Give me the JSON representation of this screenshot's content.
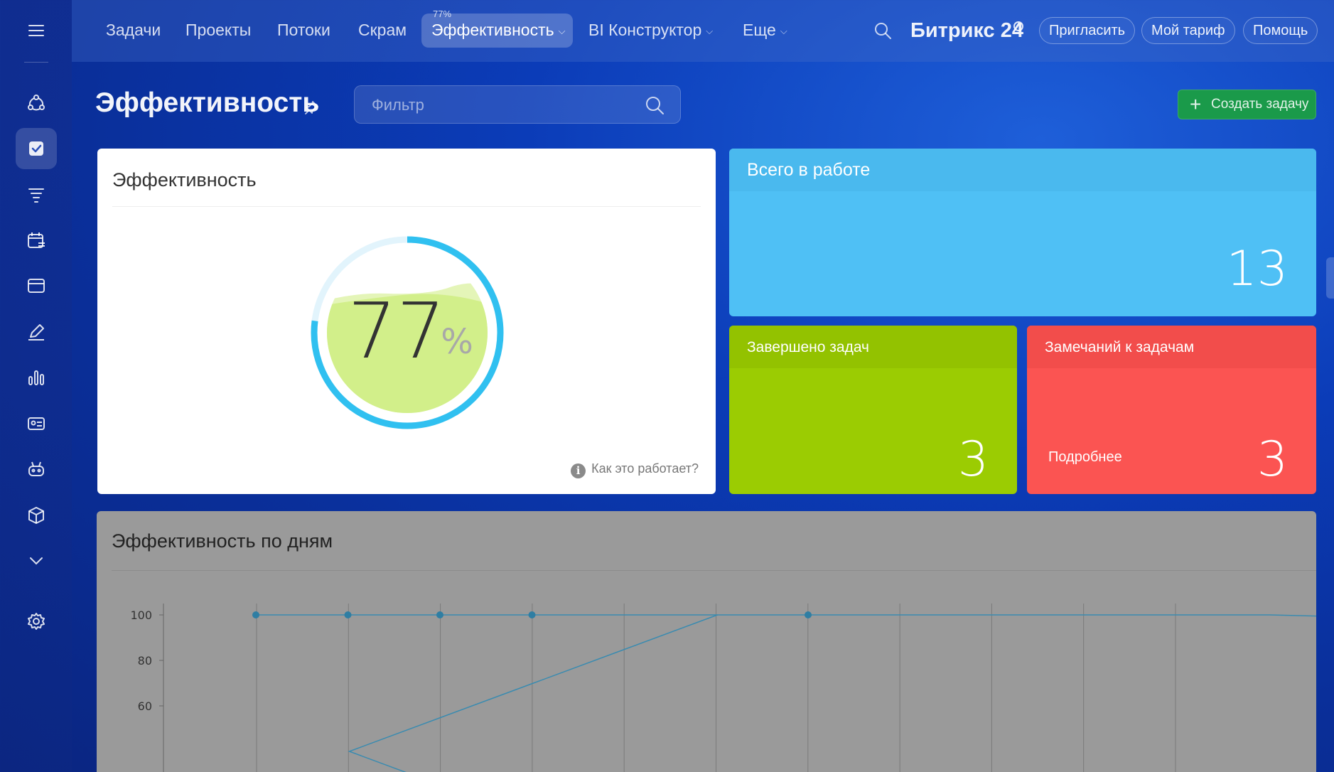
{
  "nav": {
    "items": [
      "Задачи",
      "Проекты",
      "Потоки",
      "Скрам",
      "Эффективность",
      "BI Конструктор",
      "Еще"
    ],
    "active_badge": "77%"
  },
  "brand": {
    "name": "Битрикс 24"
  },
  "top_buttons": {
    "invite": "Пригласить",
    "tariff": "Мой тариф",
    "help": "Помощь"
  },
  "page": {
    "title": "Эффективность",
    "filter_placeholder": "Фильтр",
    "create_label": "Создать задачу"
  },
  "efficiency": {
    "card_title": "Эффективность",
    "value": "77",
    "unit": "%",
    "percent": 77,
    "help_link": "Как это работает?"
  },
  "stats": {
    "in_work": {
      "title": "Всего в работе",
      "value": "13",
      "color": "#4fc0f5"
    },
    "completed": {
      "title": "Завершено задач",
      "value": "3",
      "color": "#9bcc02"
    },
    "remarks": {
      "title": "Замечаний к задачам",
      "value": "3",
      "link": "Подробнее",
      "color": "#fb5452"
    }
  },
  "days_chart": {
    "title": "Эффективность по дням"
  },
  "chart_data": {
    "type": "line",
    "title": "Эффективность по дням",
    "ylim": [
      40,
      100
    ],
    "y_ticks": [
      "100",
      "80",
      "60"
    ],
    "series": [
      {
        "values": [
          100,
          100,
          100,
          100,
          100,
          100,
          100,
          100,
          100,
          100,
          100,
          100,
          99
        ]
      },
      {
        "values": [
          null,
          40,
          55,
          70,
          85,
          100
        ]
      }
    ]
  },
  "colors": {
    "accent_blue": "#30c0f0",
    "fill_green": "#d2ef8a",
    "create_green": "#1a9a4a"
  }
}
